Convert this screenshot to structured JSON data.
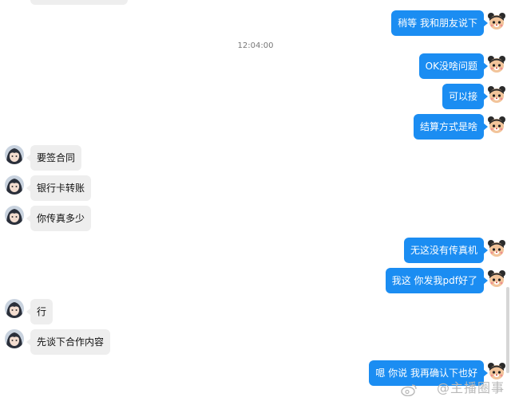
{
  "timestamp": "12:04:00",
  "messages": {
    "m1": "稍等 我和朋友说下",
    "m2": "OK没啥问题",
    "m3": "可以接",
    "m4": "结算方式是啥",
    "m5": "要签合同",
    "m6": "银行卡转账",
    "m7": "你传真多少",
    "m8": "无这没有传真机",
    "m9": "我这 你发我pdf好了",
    "m10": "行",
    "m11": "先谈下合作内容",
    "m12": "嗯 你说 我再确认下也好"
  },
  "watermark": "@主播圈事",
  "icons": {
    "self_avatar": "cartoon-bear-avatar",
    "other_avatar": "anime-character-avatar",
    "weibo": "weibo-icon"
  },
  "colors": {
    "outgoing_bubble": "#1b8df2",
    "incoming_bubble": "#eeeeee"
  }
}
